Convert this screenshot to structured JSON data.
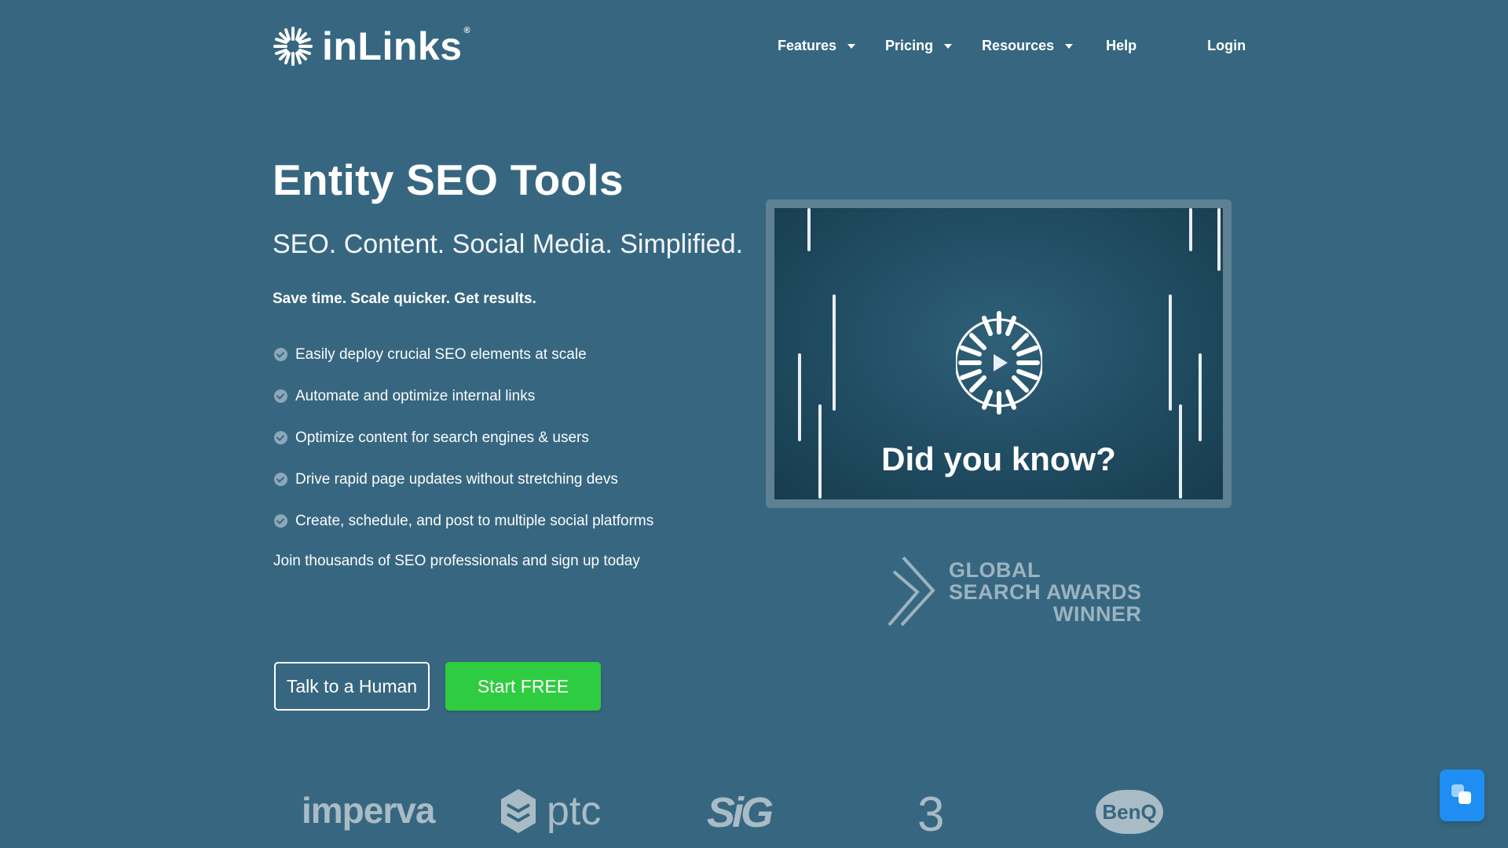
{
  "brand": {
    "name": "inLinks",
    "registered": "®"
  },
  "nav": {
    "features": "Features",
    "pricing": "Pricing",
    "resources": "Resources",
    "help": "Help",
    "login": "Login"
  },
  "hero": {
    "title": "Entity SEO Tools",
    "subtitle": "SEO. Content. Social Media. Simplified.",
    "tagline": "Save time. Scale quicker. Get results.",
    "features": [
      "Easily deploy crucial SEO elements at scale",
      "Automate and optimize internal links",
      "Optimize content for search engines & users",
      "Drive rapid page updates without stretching devs",
      "Create, schedule, and post to multiple social platforms"
    ],
    "join_text": "Join thousands of SEO professionals and sign up today",
    "cta_secondary": "Talk to a Human",
    "cta_primary": "Start FREE"
  },
  "video": {
    "caption": "Did you know?"
  },
  "award": {
    "line1": "GLOBAL",
    "line2": "SEARCH AWARDS",
    "line3": "WINNER"
  },
  "clients": {
    "imperva": "imperva",
    "ptc": "ptc",
    "sig": "SiG",
    "three": "3",
    "benq": "BenQ"
  },
  "colors": {
    "background": "#376780",
    "primary_button": "#2ecc40",
    "chat_widget": "#1e8ef2",
    "muted_logo": "#a9bcc6"
  },
  "icons": {
    "logo": "sunburst-logo-icon",
    "check": "check-circle-icon",
    "play": "play-icon",
    "award": "double-chevron-icon",
    "chat": "chat-bubble-icon"
  }
}
